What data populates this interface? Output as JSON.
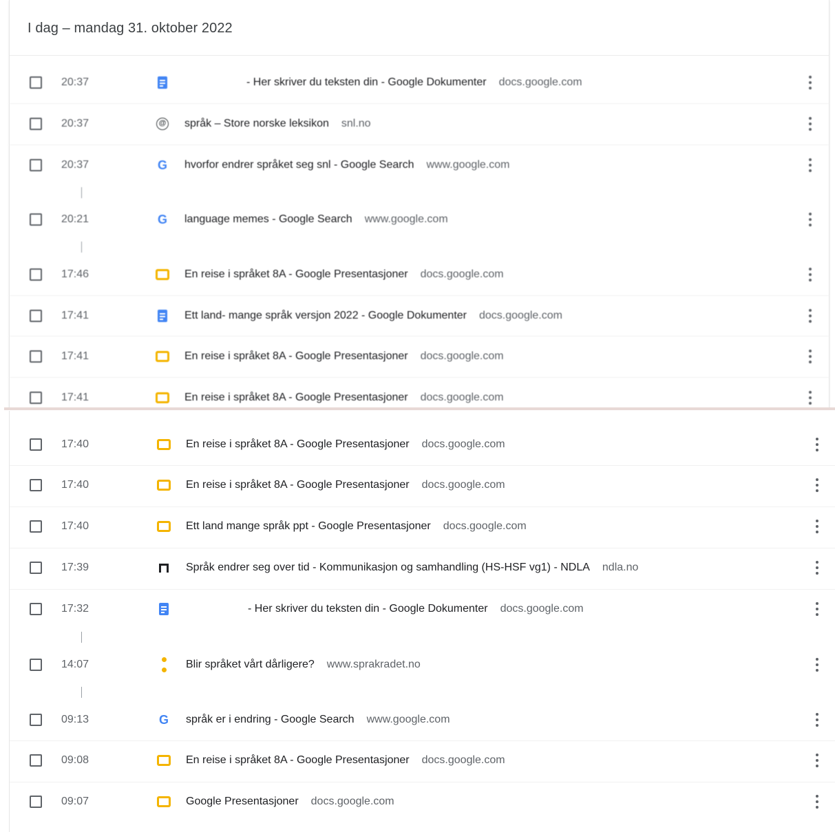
{
  "header": {
    "title": "I dag – mandag 31. oktober 2022"
  },
  "top_rows": [
    {
      "time": "20:37",
      "icon": "docs-icon",
      "title": "- Her skriver du teksten din - Google Dokumenter",
      "domain": "docs.google.com"
    },
    {
      "time": "20:37",
      "icon": "globe-icon",
      "title": "språk – Store norske leksikon",
      "domain": "snl.no"
    },
    {
      "time": "20:37",
      "icon": "google-icon",
      "title": "hvorfor endrer språket seg snl - Google Search",
      "domain": "www.google.com"
    },
    {
      "time": "20:21",
      "icon": "google-icon",
      "title": "language memes - Google Search",
      "domain": "www.google.com"
    },
    {
      "time": "17:46",
      "icon": "slides-icon",
      "title": "En reise i språket 8A - Google Presentasjoner",
      "domain": "docs.google.com"
    },
    {
      "time": "17:41",
      "icon": "docs-icon",
      "title": "Ett land- mange språk versjon 2022 - Google Dokumenter",
      "domain": "docs.google.com"
    },
    {
      "time": "17:41",
      "icon": "slides-icon",
      "title": "En reise i språket 8A - Google Presentasjoner",
      "domain": "docs.google.com"
    },
    {
      "time": "17:41",
      "icon": "slides-icon",
      "title": "En reise i språket 8A - Google Presentasjoner",
      "domain": "docs.google.com"
    }
  ],
  "bottom_rows": [
    {
      "time": "17:40",
      "icon": "slides-icon",
      "title": "En reise i språket 8A - Google Presentasjoner",
      "domain": "docs.google.com"
    },
    {
      "time": "17:40",
      "icon": "slides-icon",
      "title": "En reise i språket 8A - Google Presentasjoner",
      "domain": "docs.google.com"
    },
    {
      "time": "17:40",
      "icon": "slides-icon",
      "title": "Ett land mange språk ppt - Google Presentasjoner",
      "domain": "docs.google.com"
    },
    {
      "time": "17:39",
      "icon": "ndla-icon",
      "title": "Språk endrer seg over tid - Kommunikasjon og samhandling (HS-HSF vg1) - NDLA",
      "domain": "ndla.no"
    },
    {
      "time": "17:32",
      "icon": "docs-icon",
      "title": "- Her skriver du teksten din - Google Dokumenter",
      "domain": "docs.google.com"
    },
    {
      "time": "14:07",
      "icon": "sprakradet-icon",
      "title": "Blir språket vårt dårligere?",
      "domain": "www.sprakradet.no"
    },
    {
      "time": "09:13",
      "icon": "google-icon",
      "title": "språk er i endring - Google Search",
      "domain": "www.google.com"
    },
    {
      "time": "09:08",
      "icon": "slides-icon",
      "title": "En reise i språket 8A - Google Presentasjoner",
      "domain": "docs.google.com"
    },
    {
      "time": "09:07",
      "icon": "slides-icon",
      "title": "Google Presentasjoner",
      "domain": "docs.google.com"
    }
  ],
  "colors": {
    "docs": "#4285f4",
    "slides": "#f4b400",
    "google_blue": "#4285f4",
    "text": "#202124",
    "muted": "#5f6368"
  }
}
